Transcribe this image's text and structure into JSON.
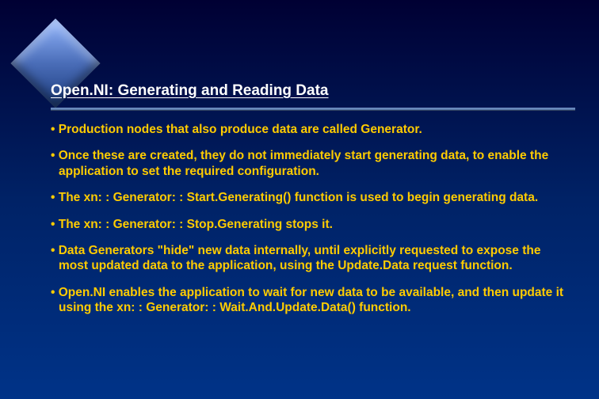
{
  "title": "Open.NI: Generating and Reading Data",
  "bullets": {
    "b0": "Production nodes that also produce data are called Generator.",
    "b1": "Once these are created, they do not immediately start generating data, to enable the application to set the required configuration.",
    "b2": "The xn: : Generator: : Start.Generating() function is used to begin generating data.",
    "b3": "The xn: : Generator: : Stop.Generating stops it.",
    "b4": "Data Generators \"hide\" new data internally, until explicitly requested to expose the most updated data to the application, using the Update.Data request function.",
    "b5": "Open.NI enables the application to wait for new data to be available, and then update it using the xn: : Generator: : Wait.And.Update.Data() function."
  }
}
